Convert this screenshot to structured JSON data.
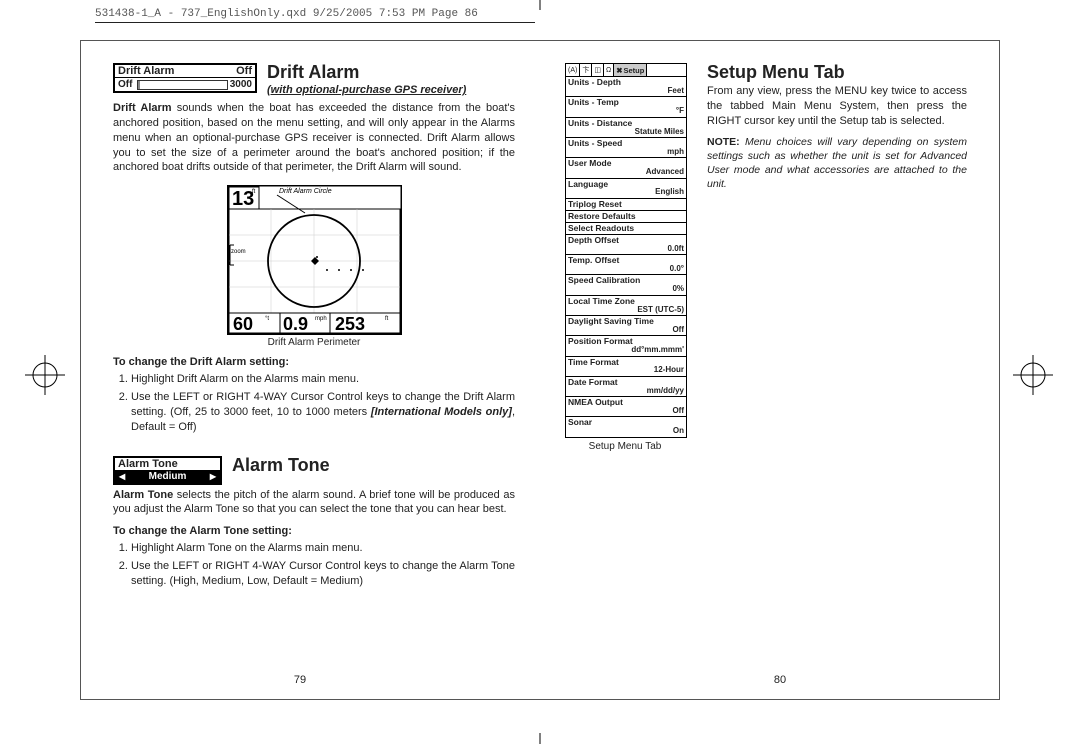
{
  "header": "531438-1_A - 737_EnglishOnly.qxd  9/25/2005  7:53 PM  Page 86",
  "left_page": {
    "drift_widget": {
      "label": "Drift Alarm",
      "status": "Off",
      "min_label": "Off",
      "max_label": "3000"
    },
    "drift_title": "Drift Alarm",
    "drift_subtitle": "(with optional-purchase GPS receiver)",
    "drift_body": "<strong>Drift Alarm</strong> sounds when the boat has exceeded the distance from the boat's anchored position, based on the menu setting, and will only appear in the Alarms menu when an optional-purchase GPS receiver is connected. Drift Alarm allows you to set the size of a perimeter around the boat's anchored position; if the anchored boat drifts outside of that perimeter, the Drift Alarm will sound.",
    "drift_fig": {
      "depth": "13",
      "depth_unit": "ft",
      "callout": "Drift Alarm Circle",
      "zoom_label": "zoom",
      "bottom_left": "60",
      "bottom_left_unit": "°t",
      "bottom_mid": "0.9",
      "bottom_mid_unit": "mph",
      "bottom_right": "253",
      "bottom_right_unit": "ft",
      "caption": "Drift Alarm Perimeter"
    },
    "drift_change_heading": "To change the Drift Alarm setting:",
    "drift_steps": [
      "Highlight Drift Alarm on the Alarms main menu.",
      "Use the LEFT or RIGHT 4-WAY Cursor Control keys to change the Drift Alarm setting. (Off, 25 to 3000 feet, 10 to 1000 meters <em><strong>[International Models only]</strong></em>, Default = Off)"
    ],
    "tone_widget": {
      "label": "Alarm Tone",
      "value": "Medium"
    },
    "tone_title": "Alarm Tone",
    "tone_body": "<strong>Alarm Tone</strong> selects the pitch of the alarm sound. A brief tone will be produced as you adjust the Alarm Tone so that you can select the tone that you can hear best.",
    "tone_change_heading": "To change the Alarm Tone setting:",
    "tone_steps": [
      "Highlight Alarm Tone on the Alarms main menu.",
      "Use the LEFT or RIGHT 4-WAY Cursor Control keys to change the Alarm Tone setting. (High, Medium, Low, Default = Medium)"
    ],
    "page_num": "79"
  },
  "right_page": {
    "setup_title": "Setup Menu Tab",
    "setup_body": "From any view, press the MENU key twice to access the tabbed Main Menu System, then press the RIGHT cursor key until the Setup tab is selected.",
    "setup_note": "<span class='note-label'>NOTE:</span> <em>Menu choices will vary depending on system settings such as whether the unit is set for Advanced User mode and what accessories are attached to the unit.</em>",
    "setup_tabs_icons": [
      "(A)",
      "卞",
      "◫",
      "Ω",
      "✖"
    ],
    "setup_active_tab": "Setup",
    "setup_menu": [
      {
        "label": "Units - Depth",
        "value": "Feet"
      },
      {
        "label": "Units - Temp",
        "value": "°F"
      },
      {
        "label": "Units - Distance",
        "value": "Statute Miles"
      },
      {
        "label": "Units - Speed",
        "value": "mph"
      },
      {
        "label": "User Mode",
        "value": "Advanced"
      },
      {
        "label": "Language",
        "value": "English"
      },
      {
        "label": "Triplog Reset",
        "value": ""
      },
      {
        "label": "Restore Defaults",
        "value": ""
      },
      {
        "label": "Select Readouts",
        "value": ""
      },
      {
        "label": "Depth Offset",
        "value": "0.0ft"
      },
      {
        "label": "Temp. Offset",
        "value": "0.0°"
      },
      {
        "label": "Speed Calibration",
        "value": "0%"
      },
      {
        "label": "Local Time Zone",
        "value": "EST (UTC-5)"
      },
      {
        "label": "Daylight Saving Time",
        "value": "Off"
      },
      {
        "label": "Position Format",
        "value": "dd°mm.mmm'"
      },
      {
        "label": "Time Format",
        "value": "12-Hour"
      },
      {
        "label": "Date Format",
        "value": "mm/dd/yy"
      },
      {
        "label": "NMEA Output",
        "value": "Off"
      },
      {
        "label": "Sonar",
        "value": "On"
      }
    ],
    "setup_caption": "Setup Menu Tab",
    "page_num": "80"
  }
}
